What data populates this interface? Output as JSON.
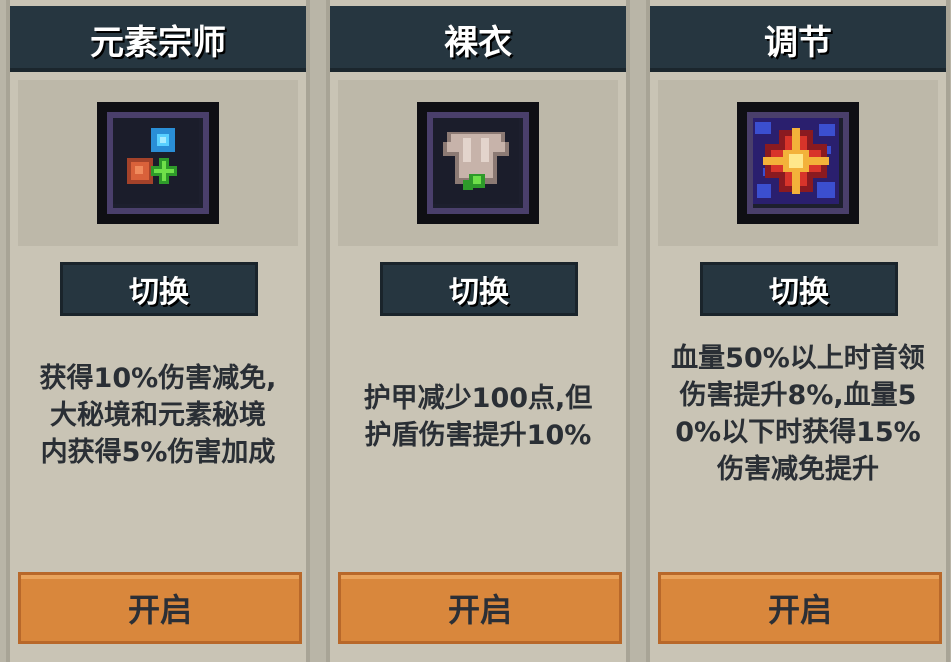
{
  "cards": [
    {
      "title": "元素宗师",
      "icon": "element-orbs-icon",
      "switch_label": "切换",
      "description": [
        "获得10%伤害减免,",
        "大秘境和元素秘境",
        "内获得5%伤害加成"
      ],
      "open_label": "开启"
    },
    {
      "title": "裸衣",
      "icon": "bare-tunic-icon",
      "switch_label": "切换",
      "description": [
        "护甲减少100点,但",
        "护盾伤害提升10%"
      ],
      "open_label": "开启"
    },
    {
      "title": "调节",
      "icon": "star-burst-icon",
      "switch_label": "切换",
      "description": [
        "血量50%以上时首领",
        "伤害提升8%,血量5",
        "0%以下时获得15%",
        "伤害减免提升"
      ],
      "open_label": "开启"
    }
  ],
  "colors": {
    "title_bar": "#263640",
    "card_bg": "#c9c4b5",
    "open_button": "#d9873c",
    "text": "#2a2f35"
  }
}
